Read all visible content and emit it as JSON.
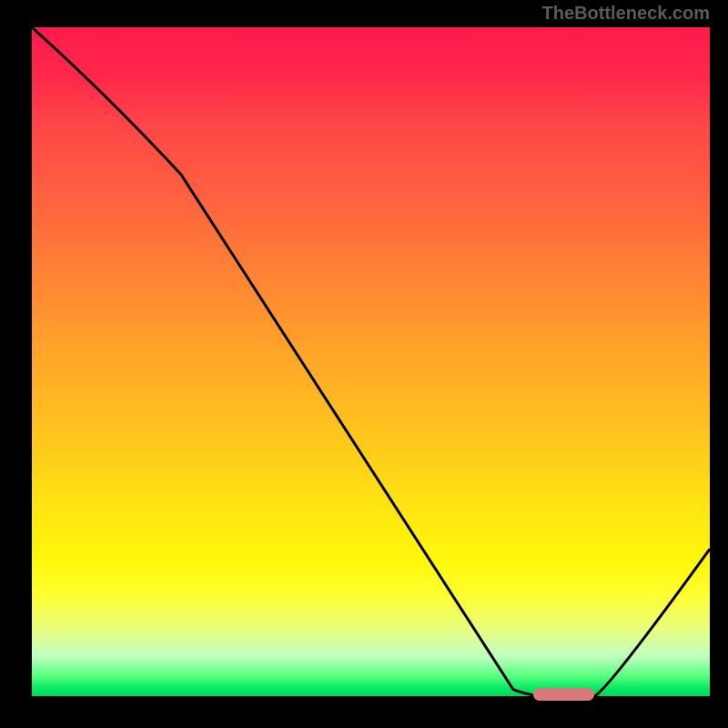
{
  "watermark": "TheBottleneck.com",
  "chart_data": {
    "type": "line",
    "title": "",
    "xlabel": "",
    "ylabel": "",
    "xlim": [
      0,
      100
    ],
    "ylim": [
      0,
      100
    ],
    "x": [
      0,
      22,
      71,
      76,
      83,
      100
    ],
    "values": [
      100,
      78,
      1,
      0,
      0,
      22
    ],
    "marker": {
      "x_start": 74,
      "x_end": 83,
      "y": 0
    },
    "gradient_stops": [
      {
        "pos": 0,
        "color": "#ff1a4d"
      },
      {
        "pos": 50,
        "color": "#ffa828"
      },
      {
        "pos": 80,
        "color": "#fff80a"
      },
      {
        "pos": 100,
        "color": "#00d858"
      }
    ]
  }
}
